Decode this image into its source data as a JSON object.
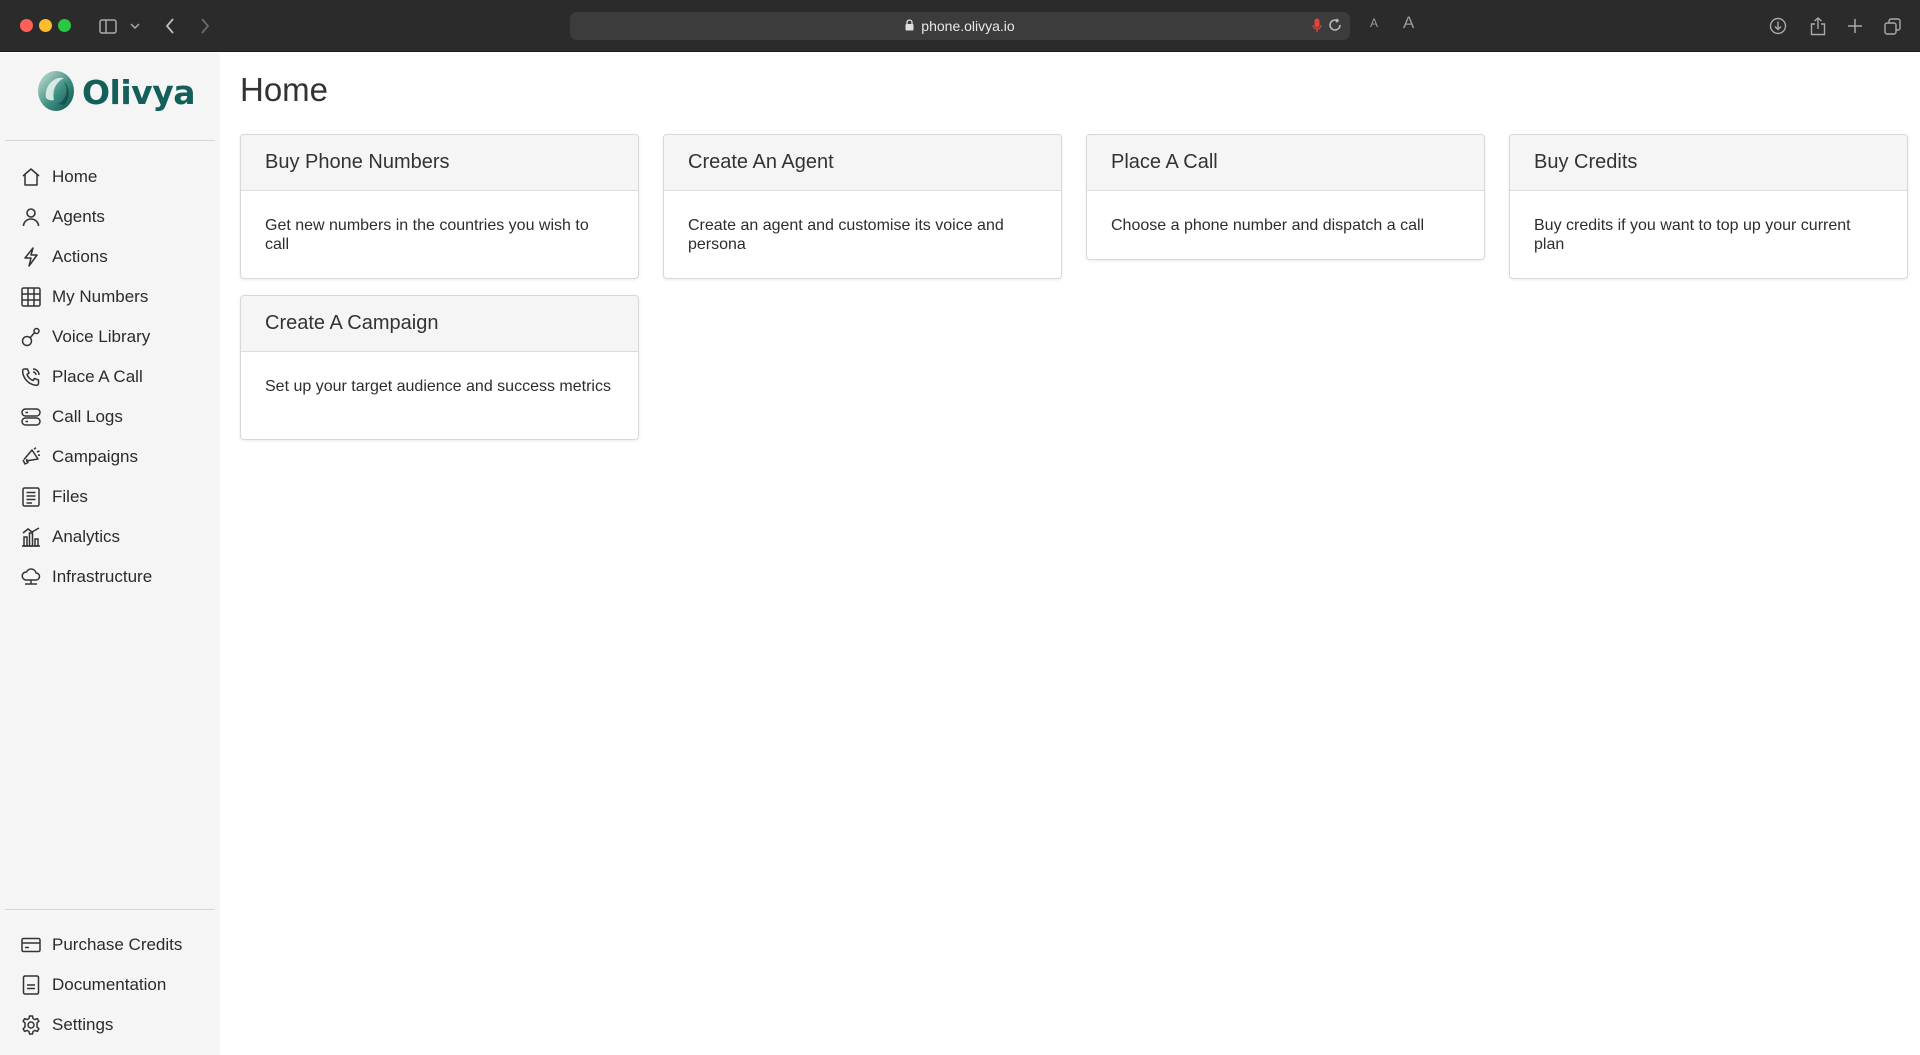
{
  "browser": {
    "url": "phone.olivya.io",
    "font_small": "A",
    "font_large": "A"
  },
  "sidebar": {
    "brand": "Olivya",
    "brand_color": "#145f5a",
    "items": [
      {
        "label": "Home",
        "icon": "home-icon"
      },
      {
        "label": "Agents",
        "icon": "person-icon"
      },
      {
        "label": "Actions",
        "icon": "lightning-icon"
      },
      {
        "label": "My Numbers",
        "icon": "grid-icon"
      },
      {
        "label": "Voice Library",
        "icon": "voice-icon"
      },
      {
        "label": "Place A Call",
        "icon": "phone-ringing-icon"
      },
      {
        "label": "Call Logs",
        "icon": "server-icon"
      },
      {
        "label": "Campaigns",
        "icon": "megaphone-icon"
      },
      {
        "label": "Files",
        "icon": "file-icon"
      },
      {
        "label": "Analytics",
        "icon": "bar-chart-icon"
      },
      {
        "label": "Infrastructure",
        "icon": "cloud-icon"
      }
    ],
    "bottom_items": [
      {
        "label": "Purchase Credits",
        "icon": "credit-card-icon"
      },
      {
        "label": "Documentation",
        "icon": "document-icon"
      },
      {
        "label": "Settings",
        "icon": "gear-icon"
      }
    ]
  },
  "main": {
    "title": "Home",
    "cards": [
      {
        "title": "Buy Phone Numbers",
        "description": "Get new numbers in the countries you wish to call"
      },
      {
        "title": "Create An Agent",
        "description": "Create an agent and customise its voice and persona"
      },
      {
        "title": "Place A Call",
        "description": "Choose a phone number and dispatch a call"
      },
      {
        "title": "Buy Credits",
        "description": "Buy credits if you want to top up your current plan"
      },
      {
        "title": "Create A Campaign",
        "description": "Set up your target audience and success metrics"
      }
    ]
  }
}
